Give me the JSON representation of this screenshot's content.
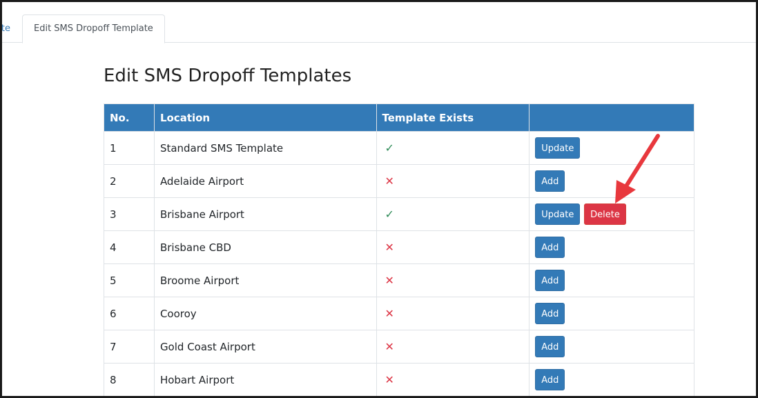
{
  "tabs": {
    "previous_label": "Edit SMS Dropoff Template",
    "active_label": "Edit SMS Dropoff Template"
  },
  "page": {
    "title": "Edit SMS Dropoff Templates"
  },
  "table": {
    "headers": {
      "no": "No.",
      "location": "Location",
      "exists": "Template Exists",
      "actions": ""
    },
    "rows": [
      {
        "no": "1",
        "location": "Standard SMS Template",
        "exists": true,
        "mark": "✓",
        "primary": "Update",
        "danger": ""
      },
      {
        "no": "2",
        "location": "Adelaide Airport",
        "exists": false,
        "mark": "✕",
        "primary": "Add",
        "danger": ""
      },
      {
        "no": "3",
        "location": "Brisbane Airport",
        "exists": true,
        "mark": "✓",
        "primary": "Update",
        "danger": "Delete"
      },
      {
        "no": "4",
        "location": "Brisbane CBD",
        "exists": false,
        "mark": "✕",
        "primary": "Add",
        "danger": ""
      },
      {
        "no": "5",
        "location": "Broome Airport",
        "exists": false,
        "mark": "✕",
        "primary": "Add",
        "danger": ""
      },
      {
        "no": "6",
        "location": "Cooroy",
        "exists": false,
        "mark": "✕",
        "primary": "Add",
        "danger": ""
      },
      {
        "no": "7",
        "location": "Gold Coast Airport",
        "exists": false,
        "mark": "✕",
        "primary": "Add",
        "danger": ""
      },
      {
        "no": "8",
        "location": "Hobart Airport",
        "exists": false,
        "mark": "✕",
        "primary": "Add",
        "danger": ""
      }
    ]
  },
  "colors": {
    "header_bg": "#337ab7",
    "primary_button": "#337ab7",
    "danger_button": "#dc3545",
    "check": "#2e8b57",
    "cross": "#dc3545",
    "annotation_arrow": "#e8383d"
  }
}
